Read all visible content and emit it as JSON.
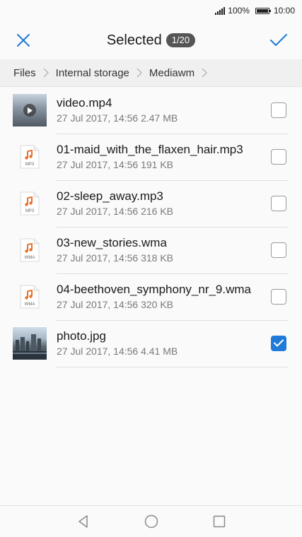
{
  "status_bar": {
    "battery": "100%",
    "time": "10:00"
  },
  "header": {
    "title": "Selected",
    "count": "1/20",
    "accent": "#1f7ad8"
  },
  "breadcrumb": [
    "Files",
    "Internal storage",
    "Mediawm"
  ],
  "files": [
    {
      "name": "video.mp4",
      "meta": "27 Jul 2017, 14:56 2.47 MB",
      "kind": "video",
      "checked": false
    },
    {
      "name": "01-maid_with_the_flaxen_hair.mp3",
      "meta": "27 Jul 2017, 14:56 191 KB",
      "kind": "audio",
      "ext": "MP3",
      "checked": false
    },
    {
      "name": "02-sleep_away.mp3",
      "meta": "27 Jul 2017, 14:56 216 KB",
      "kind": "audio",
      "ext": "MP3",
      "checked": false
    },
    {
      "name": "03-new_stories.wma",
      "meta": "27 Jul 2017, 14:56 318 KB",
      "kind": "audio",
      "ext": "WMA",
      "checked": false
    },
    {
      "name": "04-beethoven_symphony_nr_9.wma",
      "meta": "27 Jul 2017, 14:56 320 KB",
      "kind": "audio",
      "ext": "WMA",
      "checked": false
    },
    {
      "name": "photo.jpg",
      "meta": "27 Jul 2017, 14:56 4.41 MB",
      "kind": "image",
      "checked": true
    }
  ],
  "icons": {
    "close": "close-icon",
    "confirm": "checkmark-icon",
    "nav_back": "back-triangle-icon",
    "nav_home": "home-circle-icon",
    "nav_recent": "recent-square-icon"
  }
}
